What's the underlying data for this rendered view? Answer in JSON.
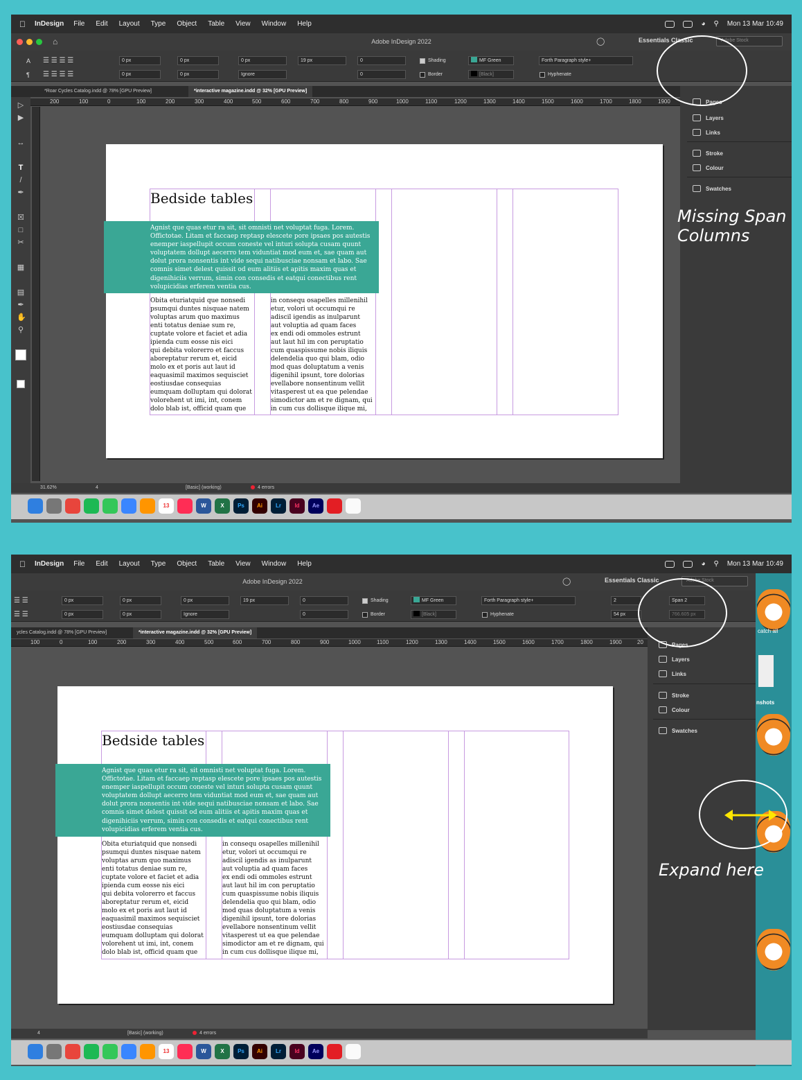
{
  "annotations": {
    "missing_span": "Missing Span\nColumns",
    "expand_here": "Expand here"
  },
  "menubar": {
    "app": "InDesign",
    "items": [
      "File",
      "Edit",
      "Layout",
      "Type",
      "Object",
      "Table",
      "View",
      "Window",
      "Help"
    ],
    "clock": "Mon 13 Mar  10:49"
  },
  "window": {
    "title": "Adobe InDesign 2022",
    "workspace": "Essentials Classic",
    "stock_placeholder": "Adobe Stock"
  },
  "control": {
    "f_zero_px": "0 px",
    "f_19px": "19 px",
    "f_zero": "0",
    "ignore": "Ignore",
    "shading": "Shading",
    "border": "Border",
    "shading_color": "MF Green",
    "border_color": "[Black]",
    "para_style": "Forth Paragraph style+",
    "hyphenate": "Hyphenate",
    "columns": "2",
    "span": "Span 2",
    "gutter": "54 px",
    "span_width": "766.605 px"
  },
  "tabs": {
    "doc1": "*Roar Cycles Catalog.indd @ 78% [GPU Preview]",
    "doc2": "*interactive magazine.indd @ 32% [GPU Preview]",
    "doc1_cut": "ycles Catalog.indd @ 78% [GPU Preview]"
  },
  "ruler1": [
    "200",
    "100",
    "0",
    "100",
    "200",
    "300",
    "400",
    "500",
    "600",
    "700",
    "800",
    "900",
    "1000",
    "1100",
    "1200",
    "1300",
    "1400",
    "1500",
    "1600",
    "1700",
    "1800",
    "1900"
  ],
  "ruler2": [
    "100",
    "0",
    "100",
    "200",
    "300",
    "400",
    "500",
    "600",
    "700",
    "800",
    "900",
    "1000",
    "1100",
    "1200",
    "1300",
    "1400",
    "1500",
    "1600",
    "1700",
    "1800",
    "1900",
    "20"
  ],
  "vruler": [
    "0",
    "1",
    "2",
    "3",
    "4",
    "5",
    "6",
    "7",
    "8",
    "9",
    "1",
    "0"
  ],
  "doc": {
    "heading": "Bedside tables",
    "teal": "Agnist que quas etur ra sit, sit omnisti net voluptat fuga. Lorem.\nOffictotae. Litam et faccaep reptasp elescete pore ipsaes pos autestis\nenemper iaspellupit occum coneste vel inturi solupta cusam quunt\nvoluptatem dollupt aecerro tem viduntiat mod eum et, sae quam aut\ndolut prora nonsentis int vide sequi natibusciae nonsam et labo. Sae\ncomnis simet delest quissit od eum alitiis et apitis maxim quas et\ndigenihiciis verrum, simin con consedis et eatqui conectibus rent\nvolupicidias erferem ventia cus.",
    "col1": "Obita eturiatquid que nonsedi\npsumqui duntes nisquae natem\nvoluptas arum quo maximus\nenti totatus deniae sum re,\ncuptate volore et faciet et adia\nipienda cum eosse nis eici\nqui debita volorerro et faccus\naboreptatur rerum et, eicid\nmolo ex et poris aut laut id\neaquasimil maximos sequisciet\neostiusdae consequias\neumquam dolluptam qui dolorat\nvolorehent ut imi, int, conem\ndolo blab ist, officid quam que",
    "col2": "in consequ osapelles millenihil\netur, volori ut occumqui re\nadiscil igendis as inulparunt\naut voluptia ad quam faces\nex endi odi ommoles estrunt\naut laut hil im con peruptatio\ncum quaspissume nobis iliquis\ndelendelia quo qui blam, odio\nmod quas doluptatum a venis\ndigenihil ipsunt, tore dolorias\nevellabore nonsentinum vellit\nvitasperest ut ea que pelendae\nsimodictor am et re dignam, qui\nin cum cus dollisque ilique mi,"
  },
  "panel": {
    "pages": "Pages",
    "layers": "Layers",
    "links": "Links",
    "stroke": "Stroke",
    "colour": "Colour",
    "swatches": "Swatches"
  },
  "status": {
    "zoom": "31.62%",
    "page": "4",
    "style": "[Basic] (working)",
    "errors": "4 errors"
  },
  "desktop": {
    "catch": "catch all",
    "shots": "nshots"
  },
  "colors": {
    "teal": "#3aa795",
    "frame": "#c79ae0",
    "arrow": "#ffe600"
  }
}
